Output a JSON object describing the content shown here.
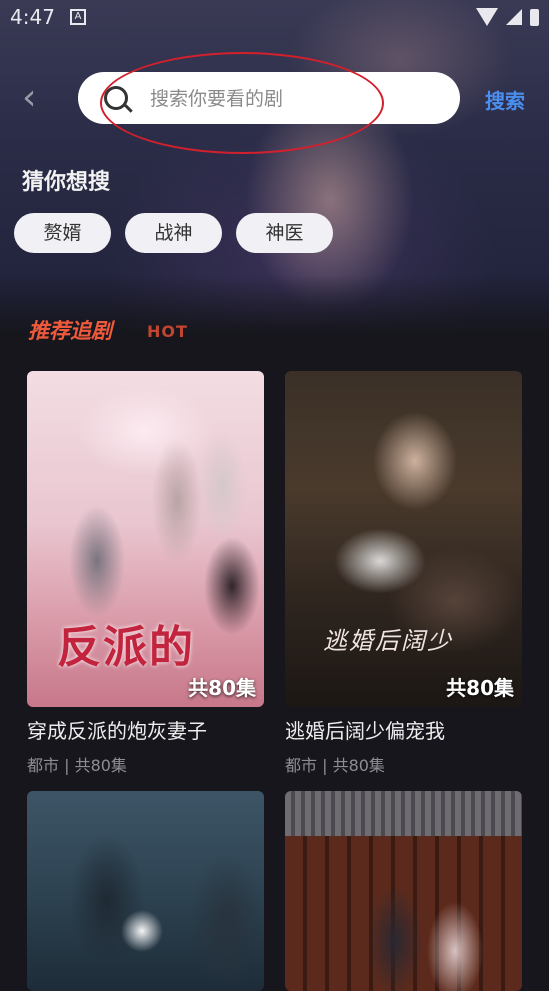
{
  "status_bar": {
    "time": "4:47",
    "notification_icon": "A"
  },
  "search": {
    "placeholder": "搜索你要看的剧",
    "button_label": "搜索"
  },
  "guess": {
    "title": "猜你想搜",
    "chips": [
      "赘婿",
      "战神",
      "神医"
    ]
  },
  "recommend": {
    "title": "推荐追剧",
    "badge": "HOT",
    "items": [
      {
        "title": "穿成反派的炮灰妻子",
        "meta": "都市 | 共80集",
        "episodes": "共80集",
        "poster_text": "反派的"
      },
      {
        "title": "逃婚后阔少偏宠我",
        "meta": "都市 | 共80集",
        "episodes": "共80集",
        "poster_text": "逃婚后阔少"
      },
      {
        "title": "",
        "meta": "",
        "episodes": ""
      },
      {
        "title": "",
        "meta": "",
        "episodes": ""
      }
    ]
  },
  "icons": [
    "back-arrow-icon",
    "search-icon",
    "wifi-icon",
    "signal-icon",
    "battery-icon"
  ],
  "colors": {
    "accent": "#4a8ff0",
    "hot": "#ef5a3c",
    "annotation": "#d4202c",
    "background": "#16161c"
  }
}
